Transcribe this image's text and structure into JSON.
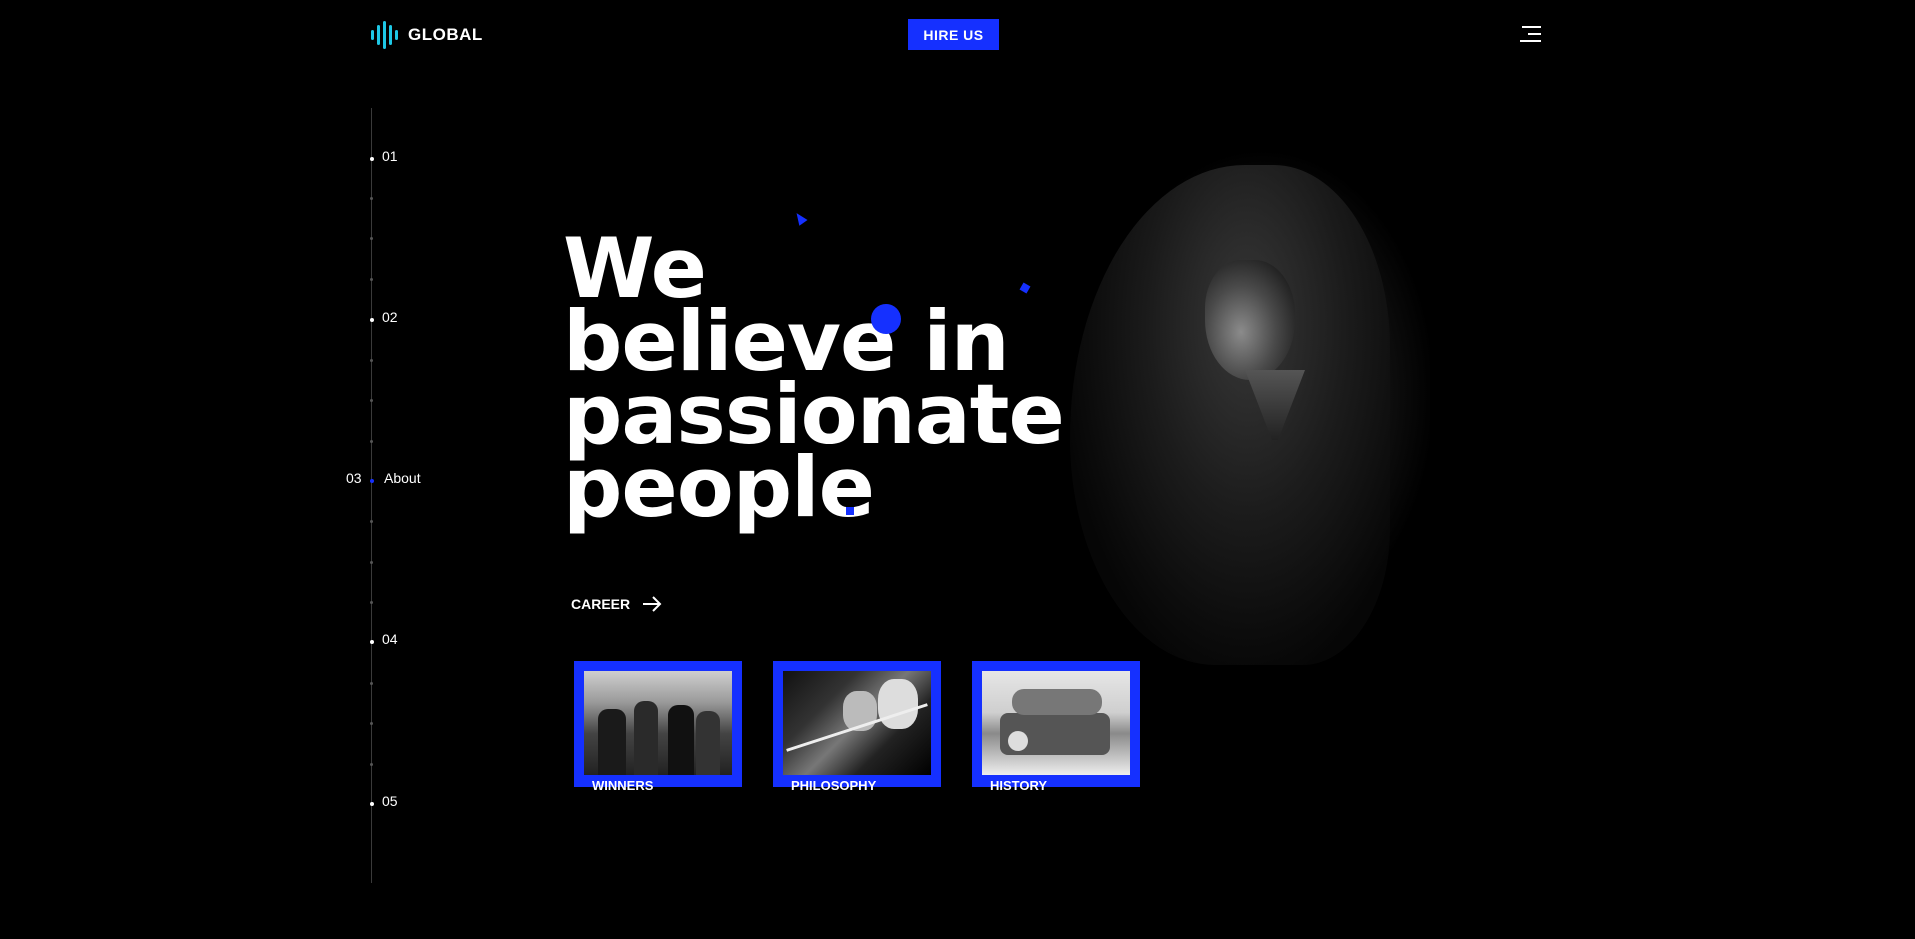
{
  "header": {
    "logo_text": "GLOBAL",
    "hire_label": "HIRE US",
    "menu_icon": "hamburger-menu-icon"
  },
  "nav": {
    "items": [
      {
        "num": "01",
        "label": ""
      },
      {
        "num": "02",
        "label": ""
      },
      {
        "num": "03",
        "label": "About",
        "active": true
      },
      {
        "num": "04",
        "label": ""
      },
      {
        "num": "05",
        "label": ""
      }
    ]
  },
  "hero": {
    "line1": "We",
    "line2": "believe in",
    "line3": "passionate",
    "line4": "people"
  },
  "career": {
    "label": "CAREER",
    "icon": "arrow-right-icon"
  },
  "cards": [
    {
      "label": "WINNERS"
    },
    {
      "label": "PHILOSOPHY"
    },
    {
      "label": "HISTORY"
    }
  ],
  "colors": {
    "accent": "#1530ff",
    "logo": "#1ec8e6",
    "background": "#000000"
  }
}
